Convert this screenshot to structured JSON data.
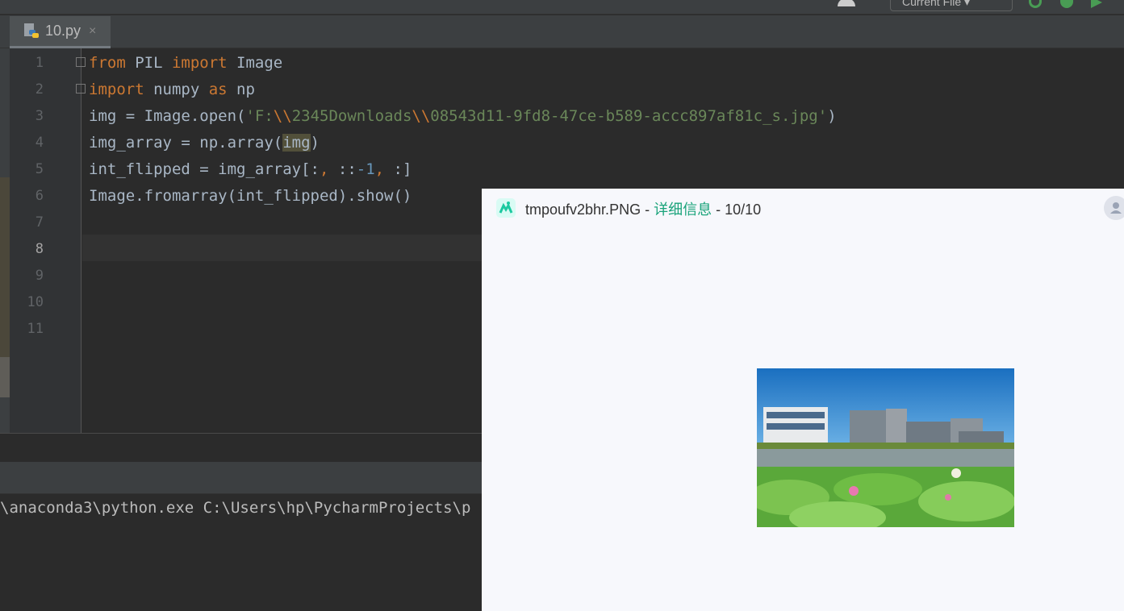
{
  "toolbar": {
    "run_config": "Current File"
  },
  "editor": {
    "tab_label": "10.py",
    "tab_close": "×",
    "line_numbers": [
      "1",
      "2",
      "3",
      "4",
      "5",
      "6",
      "7",
      "8",
      "9",
      "10",
      "11"
    ],
    "current_line": "8",
    "code": {
      "l1": {
        "k1": "from",
        "t1": " PIL ",
        "k2": "import",
        "t2": " Image"
      },
      "l2": {
        "k1": "import",
        "t1": " numpy ",
        "k2": "as",
        "t2": " np"
      },
      "l3": {
        "t1": "img = Image.open(",
        "s1": "'F:",
        "e1": "\\\\",
        "s2": "2345Downloads",
        "e2": "\\\\",
        "s3": "08543d11-9fd8-47ce-b589-accc897af81c_s.jpg'",
        "t2": ")"
      },
      "l4": {
        "t1": "img_array = np.array(",
        "h": "img",
        "t2": ")"
      },
      "l5": {
        "t1": "int_flipped = img_array[:",
        "k1": ",",
        "t2": " ::",
        "n1": "-1",
        "k2": ",",
        "t3": " :]"
      },
      "l6": {
        "t1": "Image.fromarray(int_flipped).show()"
      }
    }
  },
  "console": {
    "text": "\\anaconda3\\python.exe C:\\Users\\hp\\PycharmProjects\\p"
  },
  "viewer": {
    "filename": "tmpoufv2bhr.PNG",
    "sep1": " - ",
    "details": "详细信息",
    "sep2": " - ",
    "counter": "10/10"
  }
}
